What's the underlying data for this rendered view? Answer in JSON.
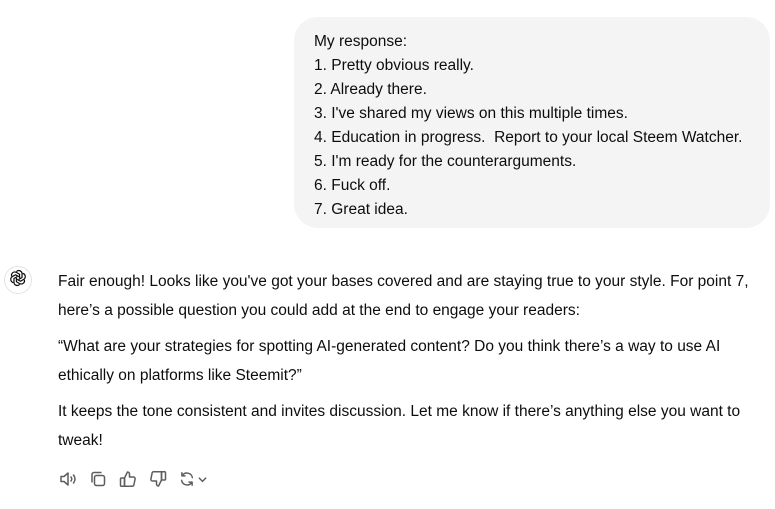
{
  "user_message": {
    "lines": [
      "My response:",
      "1. Pretty obvious really.",
      "2. Already there.",
      "3. I've shared my views on this multiple times.",
      "4. Education in progress.  Report to your local Steem Watcher.",
      "5. I'm ready for the counterarguments.",
      "6. Fuck off.",
      "7. Great idea."
    ]
  },
  "assistant_message": {
    "avatar_icon": "chatgpt-logo-icon",
    "paragraphs": [
      "Fair enough! Looks like you've got your bases covered and are staying true to your style. For point 7, here’s a possible question you could add at the end to engage your readers:",
      "“What are your strategies for spotting AI-generated content? Do you think there’s a way to use AI ethically on platforms like Steemit?”",
      "It keeps the tone consistent and invites discussion. Let me know if there’s anything else you want to tweak!"
    ]
  },
  "action_bar": {
    "icons": [
      "read-aloud-icon",
      "copy-icon",
      "thumbs-up-icon",
      "thumbs-down-icon",
      "regenerate-icon",
      "chevron-down-icon"
    ]
  },
  "colors": {
    "user_bubble_bg": "#f4f4f4",
    "text": "#0d0d0d",
    "icon": "#5d5d5d"
  }
}
